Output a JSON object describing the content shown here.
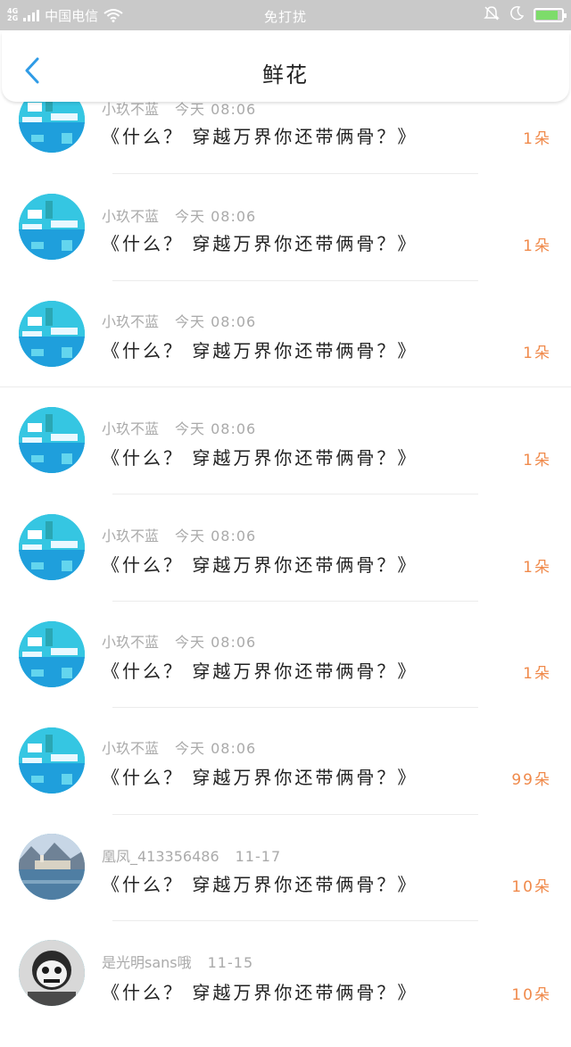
{
  "status_bar": {
    "network_tag_top": "4G",
    "network_tag_bottom": "2G",
    "carrier": "中国电信",
    "center_text": "免打扰",
    "colors": {
      "background": "#c9c9c9",
      "battery": "#7ddc6a"
    },
    "icons": [
      "signal-icon",
      "wifi-icon",
      "bell-mute-icon",
      "moon-icon",
      "battery-icon"
    ]
  },
  "nav": {
    "title": "鲜花",
    "back_icon": "chevron-left-icon",
    "accent": "#2f9be6"
  },
  "colors": {
    "count": "#f08a4b",
    "meta": "#aaaaaa",
    "message": "#222222"
  },
  "rows": [
    {
      "user": "小玖不蓝",
      "time": "今天 08:06",
      "message": "《什么？ 穿越万界你还带俩骨？》",
      "count": "1朵",
      "avatar": "blue-pixel-avatar"
    },
    {
      "user": "小玖不蓝",
      "time": "今天 08:06",
      "message": "《什么？ 穿越万界你还带俩骨？》",
      "count": "1朵",
      "avatar": "blue-pixel-avatar"
    },
    {
      "user": "小玖不蓝",
      "time": "今天 08:06",
      "message": "《什么？ 穿越万界你还带俩骨？》",
      "count": "1朵",
      "avatar": "blue-pixel-avatar"
    },
    {
      "user": "小玖不蓝",
      "time": "今天 08:06",
      "message": "《什么？ 穿越万界你还带俩骨？》",
      "count": "1朵",
      "avatar": "blue-pixel-avatar"
    },
    {
      "user": "小玖不蓝",
      "time": "今天 08:06",
      "message": "《什么？ 穿越万界你还带俩骨？》",
      "count": "1朵",
      "avatar": "blue-pixel-avatar"
    },
    {
      "user": "小玖不蓝",
      "time": "今天 08:06",
      "message": "《什么？ 穿越万界你还带俩骨？》",
      "count": "1朵",
      "avatar": "blue-pixel-avatar"
    },
    {
      "user": "小玖不蓝",
      "time": "今天 08:06",
      "message": "《什么？ 穿越万界你还带俩骨？》",
      "count": "99朵",
      "avatar": "blue-pixel-avatar"
    },
    {
      "user": "凰凤_413356486",
      "time": "11-17",
      "message": "《什么？ 穿越万界你还带俩骨？》",
      "count": "10朵",
      "avatar": "lake-town-avatar"
    },
    {
      "user": "是光明sans哦",
      "time": "11-15",
      "message": "《什么？ 穿越万界你还带俩骨？》",
      "count": "10朵",
      "avatar": "skeleton-avatar"
    }
  ]
}
